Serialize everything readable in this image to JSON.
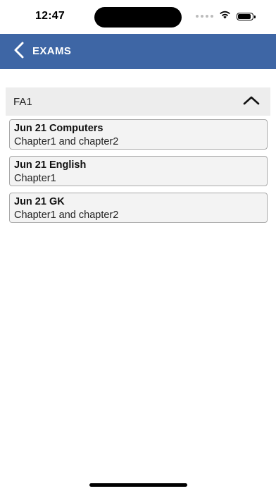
{
  "status_bar": {
    "time": "12:47",
    "battery_level": 0.9
  },
  "nav": {
    "title": "EXAMS",
    "back_icon": "chevron-left-icon"
  },
  "section": {
    "title": "FA1",
    "expanded": true,
    "toggle_icon": "chevron-up-icon"
  },
  "exams": [
    {
      "title": "Jun 21 Computers",
      "subtitle": "Chapter1 and chapter2"
    },
    {
      "title": "Jun 21 English",
      "subtitle": "Chapter1"
    },
    {
      "title": "Jun 21 GK",
      "subtitle": "Chapter1 and chapter2"
    }
  ],
  "colors": {
    "nav_background": "#3e66a5",
    "section_header_background": "#ededed",
    "card_background": "#f3f3f3",
    "card_border": "#a9a9a9"
  }
}
